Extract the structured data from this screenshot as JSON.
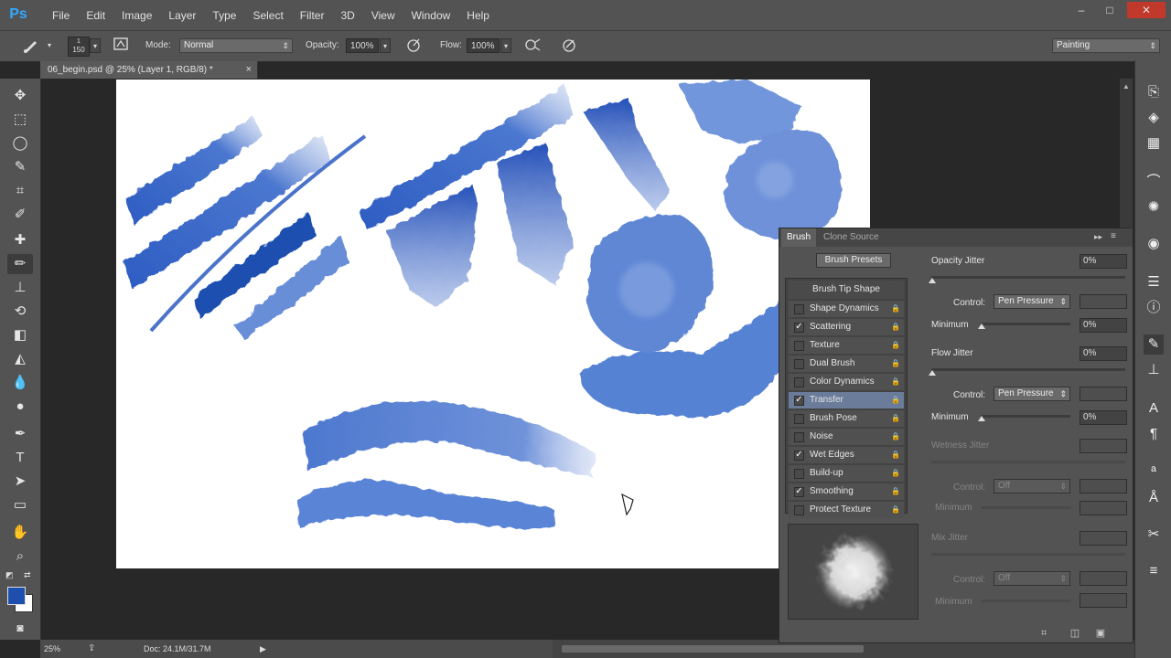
{
  "app": {
    "logo": "Ps"
  },
  "menu": [
    "File",
    "Edit",
    "Image",
    "Layer",
    "Type",
    "Select",
    "Filter",
    "3D",
    "View",
    "Window",
    "Help"
  ],
  "window_controls": {
    "minimize": "–",
    "maximize": "□",
    "close": "✕"
  },
  "options_bar": {
    "brush_size": "150",
    "brush_size_top": "1",
    "mode_label": "Mode:",
    "mode_value": "Normal",
    "opacity_label": "Opacity:",
    "opacity_value": "100%",
    "flow_label": "Flow:",
    "flow_value": "100%",
    "workspace": "Painting"
  },
  "document_tab": {
    "title": "06_begin.psd @ 25% (Layer 1, RGB/8) *",
    "close": "×"
  },
  "status_bar": {
    "zoom": "25%",
    "doc": "Doc: 24.1M/31.7M"
  },
  "brush_panel": {
    "tabs": [
      "Brush",
      "Clone Source"
    ],
    "presets_button": "Brush Presets",
    "tip_header": "Brush Tip Shape",
    "items": [
      {
        "label": "Shape Dynamics",
        "checked": false,
        "selected": false
      },
      {
        "label": "Scattering",
        "checked": true,
        "selected": false
      },
      {
        "label": "Texture",
        "checked": false,
        "selected": false
      },
      {
        "label": "Dual Brush",
        "checked": false,
        "selected": false
      },
      {
        "label": "Color Dynamics",
        "checked": false,
        "selected": false
      },
      {
        "label": "Transfer",
        "checked": true,
        "selected": true
      },
      {
        "label": "Brush Pose",
        "checked": false,
        "selected": false
      },
      {
        "label": "Noise",
        "checked": false,
        "selected": false
      },
      {
        "label": "Wet Edges",
        "checked": true,
        "selected": false
      },
      {
        "label": "Build-up",
        "checked": false,
        "selected": false
      },
      {
        "label": "Smoothing",
        "checked": true,
        "selected": false
      },
      {
        "label": "Protect Texture",
        "checked": false,
        "selected": false
      }
    ],
    "opacity_jitter": {
      "label": "Opacity Jitter",
      "value": "0%"
    },
    "control1": {
      "label": "Control:",
      "value": "Pen Pressure"
    },
    "minimum1": {
      "label": "Minimum",
      "value": "0%"
    },
    "flow_jitter": {
      "label": "Flow Jitter",
      "value": "0%"
    },
    "control2": {
      "label": "Control:",
      "value": "Pen Pressure"
    },
    "minimum2": {
      "label": "Minimum",
      "value": "0%"
    },
    "wetness_jitter": {
      "label": "Wetness Jitter"
    },
    "control3": {
      "label": "Control:",
      "value": "Off"
    },
    "minimum3": {
      "label": "Minimum"
    },
    "mix_jitter": {
      "label": "Mix Jitter"
    },
    "control4": {
      "label": "Control:",
      "value": "Off"
    },
    "minimum4": {
      "label": "Minimum"
    }
  },
  "colors": {
    "foreground": "#1f4fae",
    "background": "#ffffff",
    "paint": "#2f5fc4"
  }
}
